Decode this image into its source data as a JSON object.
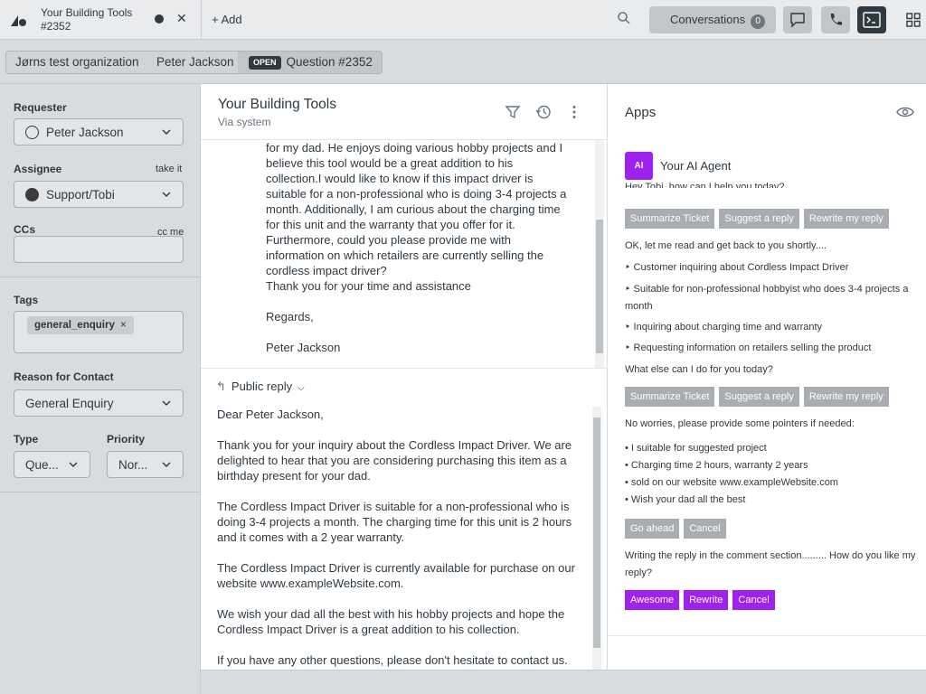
{
  "topbar": {
    "tab_title_line1": "Your Building Tools",
    "tab_title_line2": "#2352",
    "close_glyph": "✕",
    "add_label": "+ Add",
    "conversations_label": "Conversations",
    "conversations_count": "0"
  },
  "breadcrumbs": {
    "organization": "Jørns test organization",
    "requester": "Peter Jackson",
    "status_badge": "OPEN",
    "ticket": "Question #2352"
  },
  "sidebar": {
    "requester_label": "Requester",
    "requester_value": "Peter Jackson",
    "assignee_label": "Assignee",
    "take_it": "take it",
    "assignee_value": "Support/Tobi",
    "ccs_label": "CCs",
    "cc_me": "cc me",
    "tags_label": "Tags",
    "tag": "general_enquiry",
    "tag_remove": "×",
    "reason_label": "Reason for Contact",
    "reason_value": "General Enquiry",
    "type_label": "Type",
    "type_value": "Que...",
    "priority_label": "Priority",
    "priority_value": "Nor..."
  },
  "conversation": {
    "title": "Your Building Tools",
    "via": "Via system",
    "message": "for my dad. He enjoys doing various hobby projects and I\nbelieve this tool would be a great addition to his\ncollection.I would like to know if this impact driver is\nsuitable for a non-professional who is doing 3-4 projects a\nmonth. Additionally, I am curious about the charging time\nfor this unit and the warranty that you offer for it.\nFurthermore, could you please provide me with\ninformation on which retailers are currently selling the\ncordless impact driver?\nThank you for your time and assistance\n\nRegards,\n\nPeter Jackson",
    "reply_mode": "Public reply",
    "reply_text": "Dear Peter Jackson,\n\nThank you for your inquiry about the Cordless Impact Driver. We are delighted to hear that you are considering purchasing this item as a birthday present for your dad.\n\nThe Cordless Impact Driver is suitable for a non-professional who is doing 3-4 projects a month. The charging time for this unit is 2 hours and it comes with a 2 year warranty.\n\nThe Cordless Impact Driver is currently available for purchase on our website www.exampleWebsite.com.\n\nWe wish your dad all the best with his hobby projects and hope the Cordless Impact Driver is a great addition to his collection.\n\nIf you have any other questions, please don't hesitate to contact us."
  },
  "apps": {
    "title": "Apps",
    "agent_logo": "AI",
    "agent_name": "Your AI Agent",
    "greeting": "Hey Tobi, how can I help you today?",
    "btn_summarize": "Summarize Ticket",
    "btn_suggest": "Suggest a reply",
    "btn_rewrite": "Rewrite my reply",
    "read_msg": "OK, let me read and get back to you shortly....",
    "summary": [
      "‣ Customer inquiring about Cordless Impact Driver",
      "‣ Suitable for non-professional hobbyist who does 3-4 projects a month",
      "‣ Inquiring about charging time and warranty",
      "‣ Requesting information on retailers selling the product"
    ],
    "what_else": "What else can I do for you today?",
    "pointers_msg": "No worries, please provide some pointers if needed:",
    "pointers": [
      "• I suitable for suggested project",
      "• Charging time 2 hours, warranty 2 years",
      "• sold on our website www.exampleWebsite.com",
      "• Wish your dad all the best"
    ],
    "btn_go_ahead": "Go ahead",
    "btn_cancel": "Cancel",
    "writing_msg": "Writing the reply in the comment section......... How do you like my reply?",
    "btn_awesome": "Awesome",
    "btn_rewrite2": "Rewrite",
    "btn_cancel2": "Cancel"
  },
  "colors": {
    "accent_purple": "#a020f0",
    "grey_button": "#a9adb1",
    "dark": "#2f3941"
  }
}
